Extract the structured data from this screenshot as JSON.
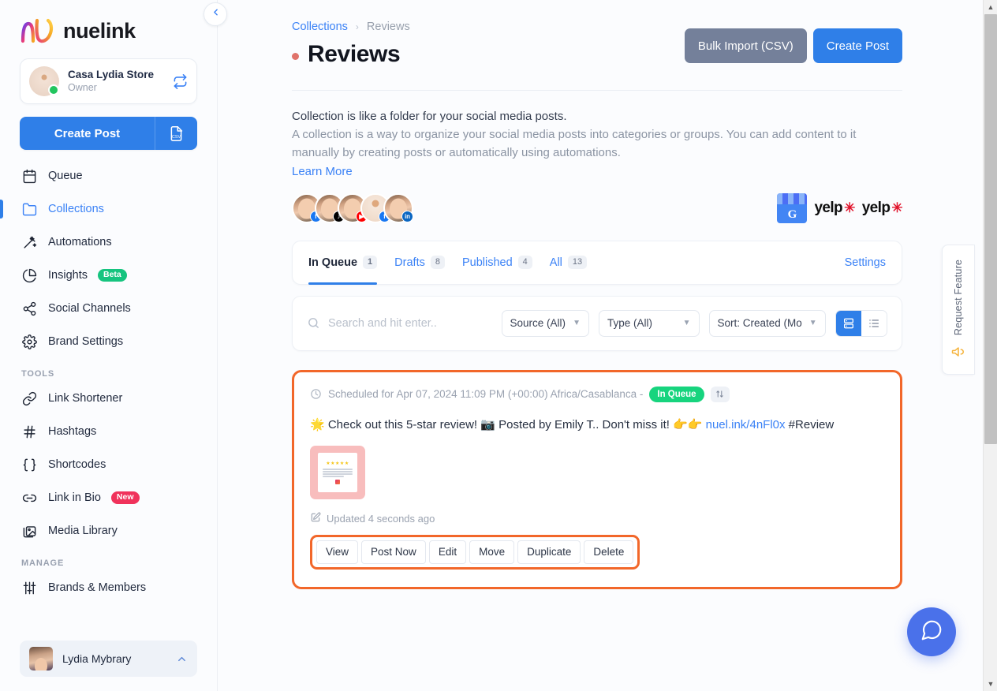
{
  "sidebar": {
    "logo_text": "nuelink",
    "brand": {
      "name": "Casa Lydia Store",
      "role": "Owner",
      "switch_icon": "switch-brand-icon"
    },
    "cta": {
      "label": "Create Post",
      "csv_icon": "csv-file-icon"
    },
    "nav": [
      {
        "label": "Queue",
        "icon": "calendar-icon",
        "active": false
      },
      {
        "label": "Collections",
        "icon": "folder-icon",
        "active": true
      },
      {
        "label": "Automations",
        "icon": "magic-wand-icon",
        "active": false
      },
      {
        "label": "Insights",
        "icon": "pie-chart-icon",
        "active": false,
        "badge": "Beta",
        "badge_kind": "beta"
      },
      {
        "label": "Social Channels",
        "icon": "share-nodes-icon",
        "active": false
      },
      {
        "label": "Brand Settings",
        "icon": "gear-icon",
        "active": false
      }
    ],
    "tools_label": "TOOLS",
    "tools": [
      {
        "label": "Link Shortener",
        "icon": "link-icon"
      },
      {
        "label": "Hashtags",
        "icon": "hashtag-icon"
      },
      {
        "label": "Shortcodes",
        "icon": "braces-icon"
      },
      {
        "label": "Link in Bio",
        "icon": "chain-icon",
        "badge": "New",
        "badge_kind": "new"
      },
      {
        "label": "Media Library",
        "icon": "images-icon"
      }
    ],
    "manage_label": "MANAGE",
    "manage": [
      {
        "label": "Brands & Members",
        "icon": "sliders-icon"
      }
    ],
    "user": {
      "name": "Lydia Mybrary",
      "chevron": "chevron-up-icon"
    },
    "collapse_icon": "chevron-left-icon"
  },
  "header": {
    "breadcrumb": {
      "parent": "Collections",
      "separator": "›",
      "current": "Reviews"
    },
    "title": "Reviews",
    "bulk_import_label": "Bulk Import (CSV)",
    "create_post_label": "Create Post"
  },
  "description": {
    "headline": "Collection is like a folder for your social media posts.",
    "body": "A collection is a way to organize your social media posts into categories or groups. You can add content to it manually by creating posts or automatically using automations.",
    "learn_more": "Learn More"
  },
  "channels": {
    "avatars": [
      {
        "name": "avatar-facebook",
        "badge": "f",
        "badge_class": "b-fb",
        "kind": "person"
      },
      {
        "name": "avatar-tiktok",
        "badge": "♪",
        "badge_class": "b-tt",
        "kind": "person"
      },
      {
        "name": "avatar-youtube",
        "badge": "▶",
        "badge_class": "b-yt",
        "kind": "person"
      },
      {
        "name": "avatar-store-facebook",
        "badge": "f",
        "badge_class": "b-fb",
        "kind": "store"
      },
      {
        "name": "avatar-linkedin",
        "badge": "in",
        "badge_class": "b-li",
        "kind": "person"
      }
    ],
    "sources": [
      {
        "name": "google-business-icon",
        "label": "G"
      },
      {
        "name": "yelp-icon",
        "label": "yelp"
      },
      {
        "name": "yelp-icon",
        "label": "yelp"
      }
    ]
  },
  "tabs": {
    "items": [
      {
        "label": "In Queue",
        "count": "1",
        "active": true
      },
      {
        "label": "Drafts",
        "count": "8",
        "active": false
      },
      {
        "label": "Published",
        "count": "4",
        "active": false
      },
      {
        "label": "All",
        "count": "13",
        "active": false
      }
    ],
    "settings_label": "Settings"
  },
  "filters": {
    "search_placeholder": "Search and hit enter..",
    "search_value": "",
    "source_label": "Source (All)",
    "type_label": "Type (All)",
    "sort_label": "Sort: Created (Mo",
    "view_grid_icon": "grid-view-icon",
    "view_list_icon": "list-view-icon",
    "active_view": "grid"
  },
  "post": {
    "schedule_text": "Scheduled for Apr 07, 2024 11:09 PM (+00:00) Africa/Casablanca -",
    "status_badge": "In Queue",
    "sort_chip_icon": "sort-arrows-icon",
    "content_prefix": "🌟 Check out this 5-star review! 📷 Posted by Emily T.. Don't miss it! 👉👉 ",
    "content_link": "nuel.ink/4nFl0x",
    "content_suffix": " #Review",
    "thumbnail_name": "post-thumbnail-review-image",
    "updated_text": "Updated 4 seconds ago",
    "actions": [
      "View",
      "Post Now",
      "Edit",
      "Move",
      "Duplicate",
      "Delete"
    ]
  },
  "rail": {
    "request_feature_label": "Request Feature",
    "request_feature_icon": "megaphone-icon",
    "chat_icon": "chat-bubble-icon"
  },
  "scrollbar": {
    "up_icon": "▲",
    "down_icon": "▼"
  },
  "colors": {
    "primary_blue": "#2f7fe8",
    "link_blue": "#3b82f6",
    "highlight_orange": "#f2672a",
    "green_badge": "#17d47e",
    "grey_button": "#74809a",
    "beta_green": "#16c47f",
    "new_red": "#f0325b"
  }
}
